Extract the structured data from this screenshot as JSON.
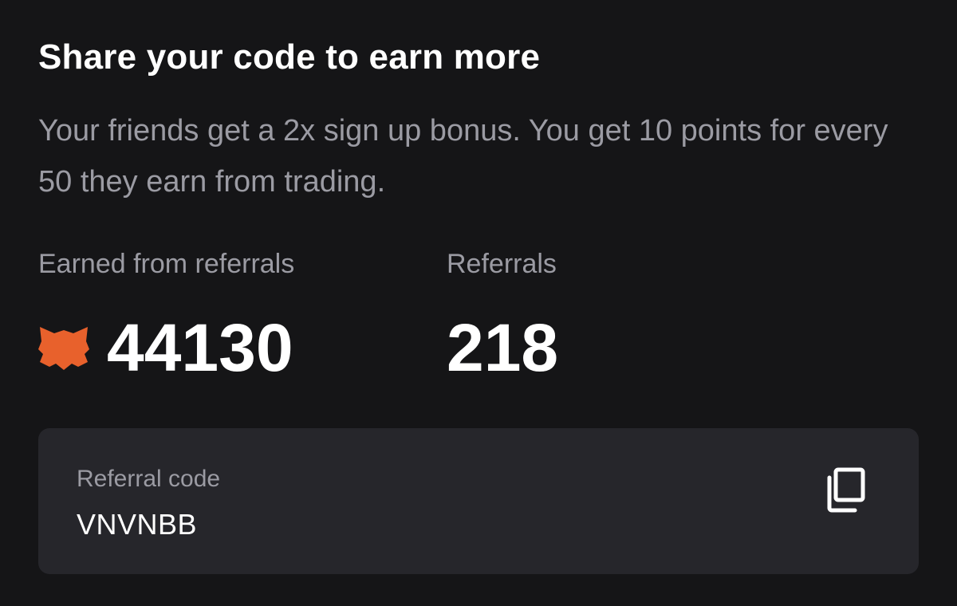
{
  "header": {
    "title": "Share your code to earn more",
    "description": "Your friends get a 2x sign up bonus. You get 10 points for every 50 they earn from trading."
  },
  "stats": {
    "earned": {
      "label": "Earned from referrals",
      "value": "44130",
      "icon": "fox-icon"
    },
    "referrals": {
      "label": "Referrals",
      "value": "218"
    }
  },
  "referral_code": {
    "label": "Referral code",
    "value": "VNVNBB",
    "copy_icon": "copy-icon"
  },
  "colors": {
    "background": "#151517",
    "card": "#26262b",
    "muted_text": "#9b9ba3",
    "accent": "#e8612c"
  }
}
